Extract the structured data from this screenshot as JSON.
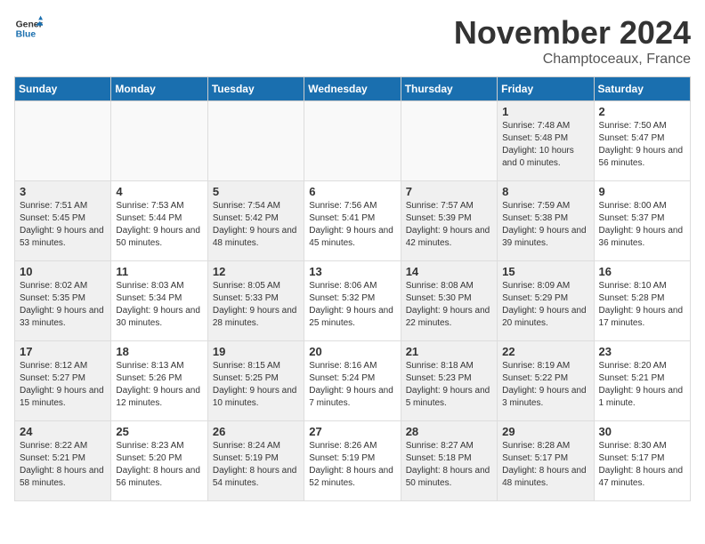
{
  "header": {
    "logo_line1": "General",
    "logo_line2": "Blue",
    "month": "November 2024",
    "location": "Champtoceaux, France"
  },
  "columns": [
    "Sunday",
    "Monday",
    "Tuesday",
    "Wednesday",
    "Thursday",
    "Friday",
    "Saturday"
  ],
  "weeks": [
    [
      {
        "day": "",
        "info": "",
        "empty": true
      },
      {
        "day": "",
        "info": "",
        "empty": true
      },
      {
        "day": "",
        "info": "",
        "empty": true
      },
      {
        "day": "",
        "info": "",
        "empty": true
      },
      {
        "day": "",
        "info": "",
        "empty": true
      },
      {
        "day": "1",
        "info": "Sunrise: 7:48 AM\nSunset: 5:48 PM\nDaylight: 10 hours and 0 minutes.",
        "shaded": true
      },
      {
        "day": "2",
        "info": "Sunrise: 7:50 AM\nSunset: 5:47 PM\nDaylight: 9 hours and 56 minutes."
      }
    ],
    [
      {
        "day": "3",
        "info": "Sunrise: 7:51 AM\nSunset: 5:45 PM\nDaylight: 9 hours and 53 minutes.",
        "shaded": true
      },
      {
        "day": "4",
        "info": "Sunrise: 7:53 AM\nSunset: 5:44 PM\nDaylight: 9 hours and 50 minutes."
      },
      {
        "day": "5",
        "info": "Sunrise: 7:54 AM\nSunset: 5:42 PM\nDaylight: 9 hours and 48 minutes.",
        "shaded": true
      },
      {
        "day": "6",
        "info": "Sunrise: 7:56 AM\nSunset: 5:41 PM\nDaylight: 9 hours and 45 minutes."
      },
      {
        "day": "7",
        "info": "Sunrise: 7:57 AM\nSunset: 5:39 PM\nDaylight: 9 hours and 42 minutes.",
        "shaded": true
      },
      {
        "day": "8",
        "info": "Sunrise: 7:59 AM\nSunset: 5:38 PM\nDaylight: 9 hours and 39 minutes.",
        "shaded": true
      },
      {
        "day": "9",
        "info": "Sunrise: 8:00 AM\nSunset: 5:37 PM\nDaylight: 9 hours and 36 minutes."
      }
    ],
    [
      {
        "day": "10",
        "info": "Sunrise: 8:02 AM\nSunset: 5:35 PM\nDaylight: 9 hours and 33 minutes.",
        "shaded": true
      },
      {
        "day": "11",
        "info": "Sunrise: 8:03 AM\nSunset: 5:34 PM\nDaylight: 9 hours and 30 minutes."
      },
      {
        "day": "12",
        "info": "Sunrise: 8:05 AM\nSunset: 5:33 PM\nDaylight: 9 hours and 28 minutes.",
        "shaded": true
      },
      {
        "day": "13",
        "info": "Sunrise: 8:06 AM\nSunset: 5:32 PM\nDaylight: 9 hours and 25 minutes."
      },
      {
        "day": "14",
        "info": "Sunrise: 8:08 AM\nSunset: 5:30 PM\nDaylight: 9 hours and 22 minutes.",
        "shaded": true
      },
      {
        "day": "15",
        "info": "Sunrise: 8:09 AM\nSunset: 5:29 PM\nDaylight: 9 hours and 20 minutes.",
        "shaded": true
      },
      {
        "day": "16",
        "info": "Sunrise: 8:10 AM\nSunset: 5:28 PM\nDaylight: 9 hours and 17 minutes."
      }
    ],
    [
      {
        "day": "17",
        "info": "Sunrise: 8:12 AM\nSunset: 5:27 PM\nDaylight: 9 hours and 15 minutes.",
        "shaded": true
      },
      {
        "day": "18",
        "info": "Sunrise: 8:13 AM\nSunset: 5:26 PM\nDaylight: 9 hours and 12 minutes."
      },
      {
        "day": "19",
        "info": "Sunrise: 8:15 AM\nSunset: 5:25 PM\nDaylight: 9 hours and 10 minutes.",
        "shaded": true
      },
      {
        "day": "20",
        "info": "Sunrise: 8:16 AM\nSunset: 5:24 PM\nDaylight: 9 hours and 7 minutes."
      },
      {
        "day": "21",
        "info": "Sunrise: 8:18 AM\nSunset: 5:23 PM\nDaylight: 9 hours and 5 minutes.",
        "shaded": true
      },
      {
        "day": "22",
        "info": "Sunrise: 8:19 AM\nSunset: 5:22 PM\nDaylight: 9 hours and 3 minutes.",
        "shaded": true
      },
      {
        "day": "23",
        "info": "Sunrise: 8:20 AM\nSunset: 5:21 PM\nDaylight: 9 hours and 1 minute."
      }
    ],
    [
      {
        "day": "24",
        "info": "Sunrise: 8:22 AM\nSunset: 5:21 PM\nDaylight: 8 hours and 58 minutes.",
        "shaded": true
      },
      {
        "day": "25",
        "info": "Sunrise: 8:23 AM\nSunset: 5:20 PM\nDaylight: 8 hours and 56 minutes."
      },
      {
        "day": "26",
        "info": "Sunrise: 8:24 AM\nSunset: 5:19 PM\nDaylight: 8 hours and 54 minutes.",
        "shaded": true
      },
      {
        "day": "27",
        "info": "Sunrise: 8:26 AM\nSunset: 5:19 PM\nDaylight: 8 hours and 52 minutes."
      },
      {
        "day": "28",
        "info": "Sunrise: 8:27 AM\nSunset: 5:18 PM\nDaylight: 8 hours and 50 minutes.",
        "shaded": true
      },
      {
        "day": "29",
        "info": "Sunrise: 8:28 AM\nSunset: 5:17 PM\nDaylight: 8 hours and 48 minutes.",
        "shaded": true
      },
      {
        "day": "30",
        "info": "Sunrise: 8:30 AM\nSunset: 5:17 PM\nDaylight: 8 hours and 47 minutes."
      }
    ]
  ]
}
